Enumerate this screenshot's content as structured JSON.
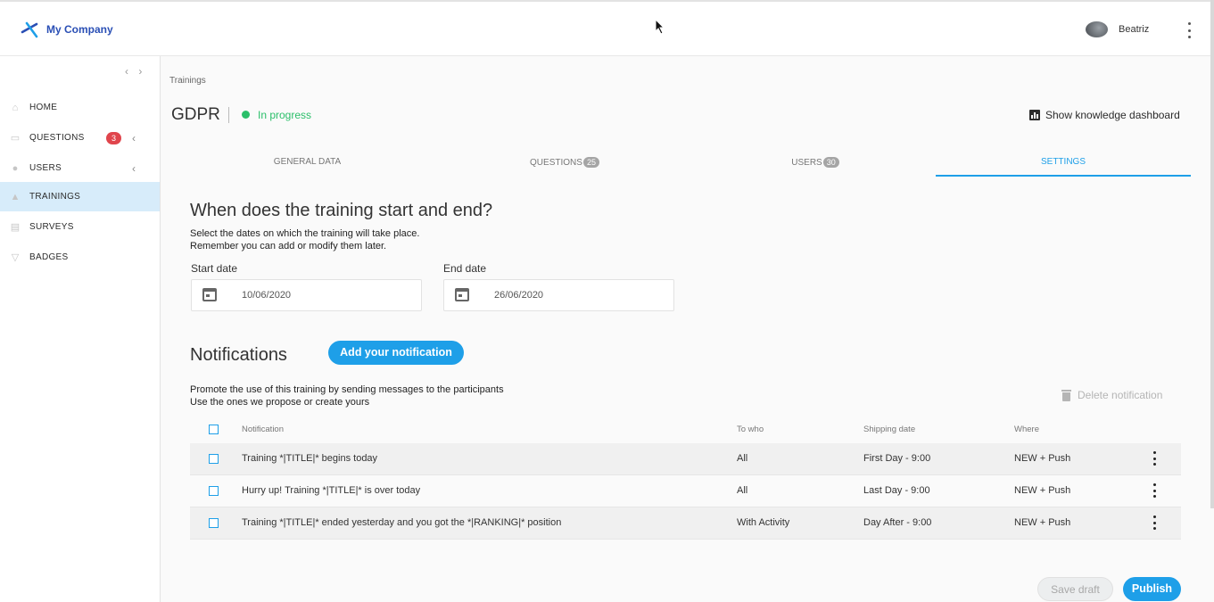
{
  "brand": {
    "name": "My Company"
  },
  "user": {
    "name": "Beatriz"
  },
  "sidebar": {
    "collapse_glyph": "‹ ›",
    "items": [
      {
        "label": "HOME",
        "icon": "home-icon"
      },
      {
        "label": "QUESTIONS",
        "icon": "questions-icon",
        "badge": "3"
      },
      {
        "label": "USERS",
        "icon": "users-icon"
      },
      {
        "label": "TRAININGS",
        "icon": "trainings-icon",
        "active": true
      },
      {
        "label": "SURVEYS",
        "icon": "surveys-icon"
      },
      {
        "label": "BADGES",
        "icon": "badges-icon"
      }
    ]
  },
  "breadcrumb": "Trainings",
  "page": {
    "title": "GDPR",
    "status": "In progress",
    "status_color": "#2bbf6a",
    "knowledge_dashboard": "Show knowledge dashboard"
  },
  "tabs": [
    {
      "label": "GENERAL DATA"
    },
    {
      "label": "QUESTIONS",
      "count": "25"
    },
    {
      "label": "USERS",
      "count": "30"
    },
    {
      "label": "SETTINGS",
      "active": true
    }
  ],
  "schedule": {
    "heading": "When does the training start and end?",
    "line1": "Select the dates on which the training will take place.",
    "line2": "Remember you can add or modify them later.",
    "start_label": "Start date",
    "start_value": "10/06/2020",
    "end_label": "End date",
    "end_value": "26/06/2020"
  },
  "notifications": {
    "heading": "Notifications",
    "add_button": "Add your notification",
    "line1": "Promote the use of this training by sending messages to the participants",
    "line2": "Use the ones we propose or create yours",
    "delete_label": "Delete notification",
    "columns": {
      "notification": "Notification",
      "to_who": "To who",
      "shipping_date": "Shipping date",
      "where": "Where"
    },
    "rows": [
      {
        "notification": "Training *|TITLE|* begins today",
        "to_who": "All",
        "shipping_date": "First Day - 9:00",
        "where": "NEW + Push"
      },
      {
        "notification": "Hurry up! Training *|TITLE|* is over today",
        "to_who": "All",
        "shipping_date": "Last Day - 9:00",
        "where": "NEW + Push"
      },
      {
        "notification": "Training *|TITLE|* ended yesterday and you got the *|RANKING|* position",
        "to_who": "With Activity",
        "shipping_date": "Day After - 9:00",
        "where": "NEW + Push"
      }
    ]
  },
  "footer": {
    "save_draft": "Save draft",
    "publish": "Publish"
  },
  "colors": {
    "accent": "#1e9fe8",
    "brand": "#2a4fb5",
    "badge": "#e0454c",
    "active_nav": "#d7ecfa"
  }
}
